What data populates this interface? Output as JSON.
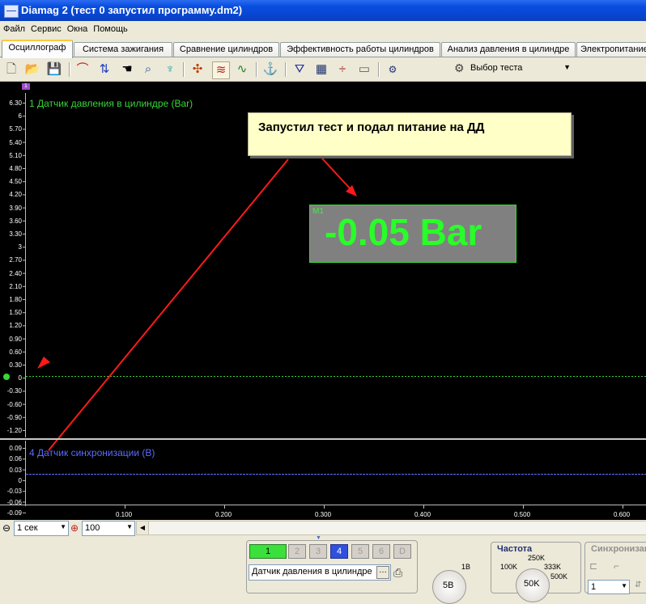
{
  "window": {
    "title": "Diamag 2 (тест 0  запустил программу.dm2)"
  },
  "menu": [
    "Файл",
    "Сервис",
    "Окна",
    "Помощь"
  ],
  "tabs": [
    {
      "label": "Осциллограф",
      "active": true
    },
    {
      "label": "Система зажигания"
    },
    {
      "label": "Сравнение цилиндров"
    },
    {
      "label": "Эффективность работы цилиндров"
    },
    {
      "label": "Анализ давления в цилиндре"
    },
    {
      "label": "Электропитание"
    }
  ],
  "toolbar": {
    "test_select": "Выбор теста",
    "icons": [
      "new-icon",
      "open-icon",
      "save-icon",
      "cursor-icon",
      "measure-icon",
      "hand-icon",
      "zoom-icon",
      "tree-icon",
      "filter-icon",
      "wave-icon",
      "wave2-icon",
      "anchor-icon",
      "trigger-icon",
      "table-icon",
      "split-icon",
      "page-icon",
      "auto-icon"
    ]
  },
  "channel1": {
    "label": "1 Датчик давления в цилиндре (Bar)",
    "ticks": [
      "6.30",
      "6",
      "5.70",
      "5.40",
      "5.10",
      "4.80",
      "4.50",
      "4.20",
      "3.90",
      "3.60",
      "3.30",
      "3",
      "2.70",
      "2.40",
      "2.10",
      "1.80",
      "1.50",
      "1.20",
      "0.90",
      "0.60",
      "0.30",
      "0",
      "-0.30",
      "-0.60",
      "-0.90",
      "-1.20"
    ],
    "color": "#38d638"
  },
  "channel4": {
    "label": "4 Датчик синхронизации (В)",
    "ticks": [
      "0.09",
      "0.06",
      "0.03",
      "0",
      "-0.03",
      "-0.06",
      "-0.09"
    ],
    "color": "#5a6cff"
  },
  "callout": {
    "text": "Запустил тест и подал питание на ДД"
  },
  "measurement": {
    "tag": "M1",
    "value": "-0.05 Bar"
  },
  "time_axis": [
    "0.100",
    "0.200",
    "0.300",
    "0.400",
    "0.500",
    "0.600"
  ],
  "timebar": {
    "scale": "1 сек",
    "zoom": "100"
  },
  "bottom": {
    "channels": [
      "1",
      "2",
      "3",
      "4",
      "5",
      "6",
      "D"
    ],
    "sensor": "Датчик давления в цилиндре",
    "voltage_knob": "5В",
    "voltage_small": "1В",
    "freq_title": "Частота",
    "freq_knob": "50K",
    "freq_marks": [
      "100K",
      "250K",
      "333K",
      "500K"
    ],
    "sync_title": "Синхронизация",
    "sync_value": "1"
  }
}
